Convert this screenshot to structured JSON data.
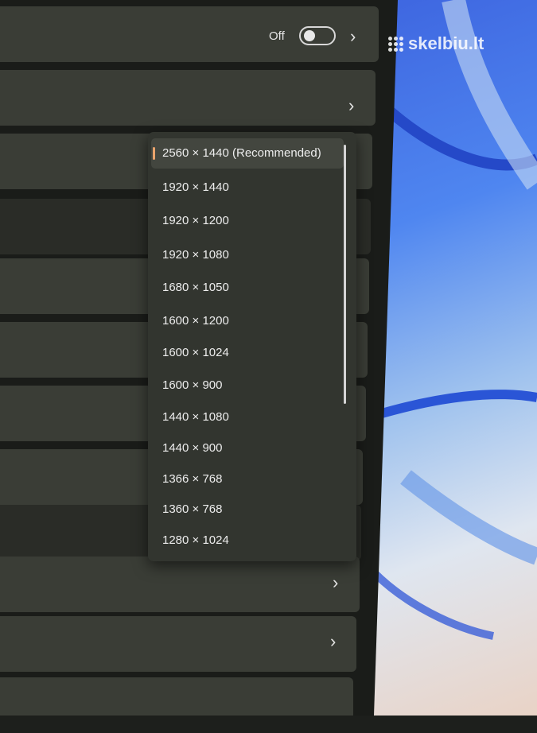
{
  "toggle": {
    "label": "Off",
    "state": "off"
  },
  "chevrons": [
    "chevron-right-icon"
  ],
  "dropdown": {
    "items": [
      {
        "label": "2560 × 1440 (Recommended)",
        "selected": true
      },
      {
        "label": "1920 × 1440"
      },
      {
        "label": "1920 × 1200"
      },
      {
        "label": "1920 × 1080"
      },
      {
        "label": "1680 × 1050"
      },
      {
        "label": "1600 × 1200"
      },
      {
        "label": "1600 × 1024"
      },
      {
        "label": "1600 × 900"
      },
      {
        "label": "1440 × 1080"
      },
      {
        "label": "1440 × 900"
      },
      {
        "label": "1366 × 768"
      },
      {
        "label": "1360 × 768"
      },
      {
        "label": "1280 × 1024"
      }
    ]
  },
  "watermark": {
    "text": "skelbiu.lt"
  },
  "colors": {
    "accent": "#e9a36c",
    "panel": "#3a3d36",
    "dropdown": "#32352f",
    "wallpaper": "#4f86f0"
  }
}
